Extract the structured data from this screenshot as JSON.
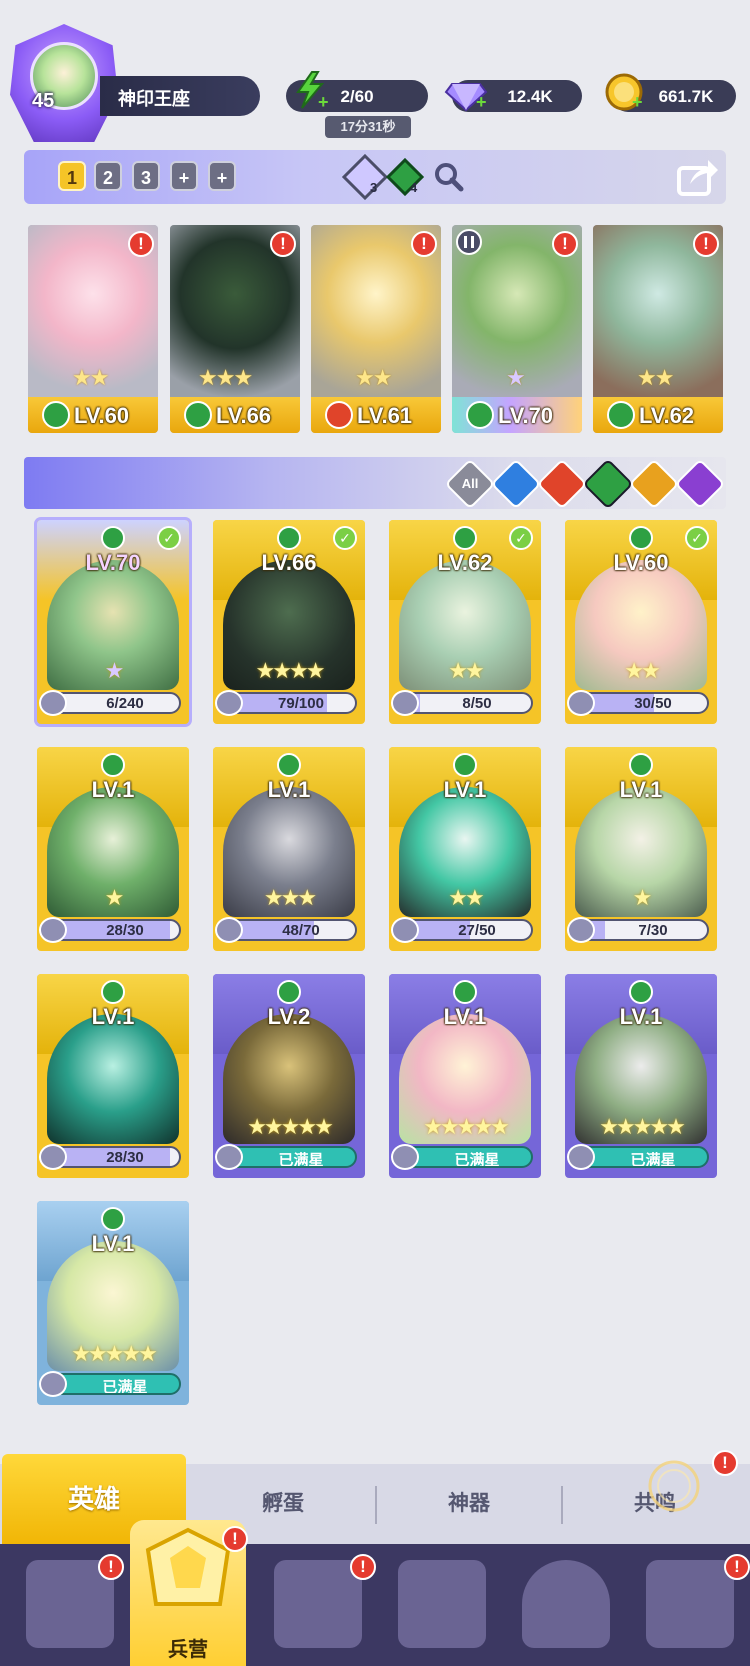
{
  "player": {
    "level": "45",
    "name": "神印王座"
  },
  "resources": {
    "energy": "2/60",
    "energy_timer": "17分31秒",
    "gems": "12.4K",
    "coins": "661.7K"
  },
  "team": {
    "tabs": [
      "1",
      "2",
      "3",
      "+",
      "+"
    ],
    "rune_counts": [
      "3",
      "4"
    ]
  },
  "team_cards": [
    {
      "level": "LV.60",
      "element": "wind",
      "stars": "★★",
      "alert": "!"
    },
    {
      "level": "LV.66",
      "element": "wind",
      "stars": "★★★",
      "alert": "!"
    },
    {
      "level": "LV.61",
      "element": "fire",
      "stars": "★★",
      "alert": "!"
    },
    {
      "level": "LV.70",
      "element": "wind",
      "stars": "★",
      "alert": "!"
    },
    {
      "level": "LV.62",
      "element": "wind",
      "stars": "★★",
      "alert": "!"
    }
  ],
  "filters": [
    "All",
    "water",
    "fire",
    "wind",
    "light",
    "dark"
  ],
  "filter_all_label": "All",
  "heroes": [
    {
      "level": "LV.70",
      "progress": "6/240",
      "fill": 0.025,
      "checked": true,
      "rarity": "gold",
      "stars": "★"
    },
    {
      "level": "LV.66",
      "progress": "79/100",
      "fill": 0.79,
      "checked": true,
      "rarity": "gold",
      "stars": "★★★★"
    },
    {
      "level": "LV.62",
      "progress": "8/50",
      "fill": 0.16,
      "checked": true,
      "rarity": "gold",
      "stars": "★★"
    },
    {
      "level": "LV.60",
      "progress": "30/50",
      "fill": 0.6,
      "checked": true,
      "rarity": "gold",
      "stars": "★★"
    },
    {
      "level": "LV.1",
      "progress": "28/30",
      "fill": 0.93,
      "checked": false,
      "rarity": "gold",
      "stars": "★"
    },
    {
      "level": "LV.1",
      "progress": "48/70",
      "fill": 0.69,
      "checked": false,
      "rarity": "gold",
      "stars": "★★★"
    },
    {
      "level": "LV.1",
      "progress": "27/50",
      "fill": 0.54,
      "checked": false,
      "rarity": "gold",
      "stars": "★★"
    },
    {
      "level": "LV.1",
      "progress": "7/30",
      "fill": 0.23,
      "checked": false,
      "rarity": "gold",
      "stars": "★"
    },
    {
      "level": "LV.1",
      "progress": "28/30",
      "fill": 0.93,
      "checked": false,
      "rarity": "gold",
      "stars": ""
    },
    {
      "level": "LV.2",
      "progress": "已满星",
      "fill": 1,
      "checked": false,
      "rarity": "purple",
      "stars": "★★★★★"
    },
    {
      "level": "LV.1",
      "progress": "已满星",
      "fill": 1,
      "checked": false,
      "rarity": "purple",
      "stars": "★★★★★"
    },
    {
      "level": "LV.1",
      "progress": "已满星",
      "fill": 1,
      "checked": false,
      "rarity": "purple",
      "stars": "★★★★★"
    },
    {
      "level": "LV.1",
      "progress": "已满星",
      "fill": 1,
      "checked": false,
      "rarity": "blue",
      "stars": "★★★★★"
    }
  ],
  "sub_tabs": [
    "英雄",
    "孵蛋",
    "神器",
    "共鸣"
  ],
  "bottom_nav": {
    "active_label": "兵营",
    "items": [
      "cards-icon",
      "barracks-icon",
      "map-icon",
      "castle-icon",
      "mushroom-icon",
      "banner-icon"
    ]
  },
  "colors": {
    "gold": "#f5c427",
    "wind": "#2ea043",
    "fire": "#e0442a",
    "water": "#2f7fe0",
    "light": "#e8a11e",
    "dark": "#8a3fd1",
    "purple_card": "#7566d8",
    "alert": "#e53b2f"
  }
}
